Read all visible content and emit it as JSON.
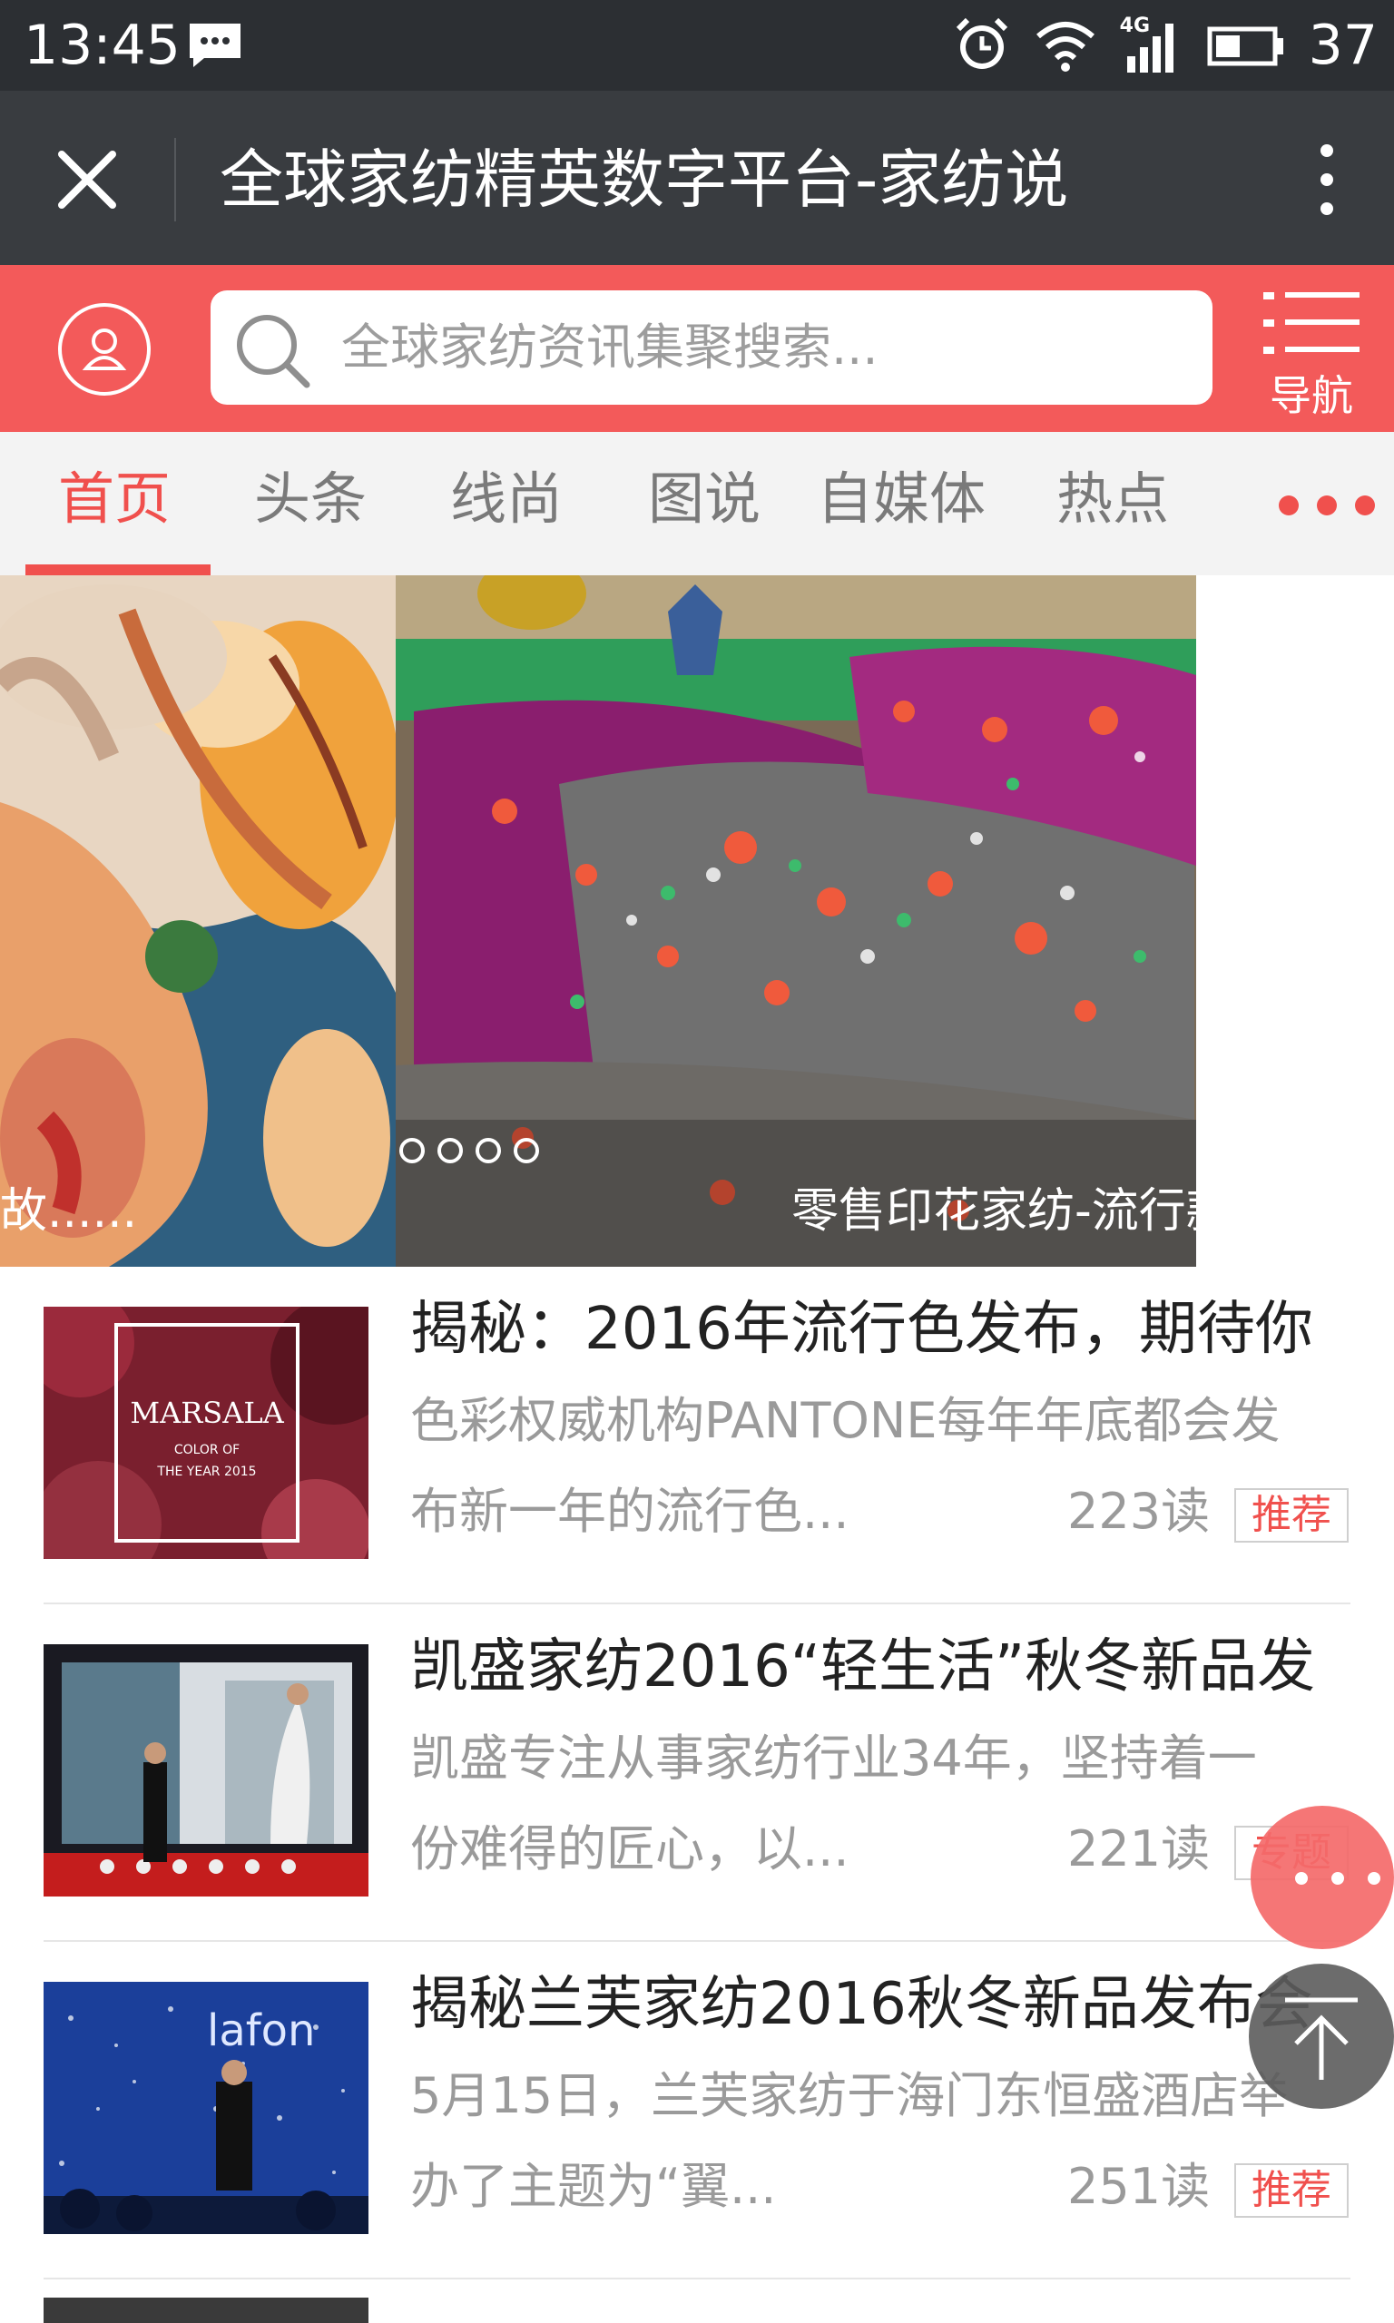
{
  "status_bar": {
    "time": "13:45",
    "network": "4G",
    "battery": "37",
    "icons": [
      "message-icon",
      "alarm-icon",
      "wifi-icon",
      "signal-icon",
      "battery-icon"
    ]
  },
  "title_bar": {
    "title": "全球家纺精英数字平台-家纺说"
  },
  "header": {
    "search_placeholder": "全球家纺资讯集聚搜索...",
    "nav_label": "导航"
  },
  "tabs": [
    {
      "label": "首页",
      "active": true
    },
    {
      "label": "头条",
      "active": false
    },
    {
      "label": "线尚",
      "active": false
    },
    {
      "label": "图说",
      "active": false
    },
    {
      "label": "自媒体",
      "active": false
    },
    {
      "label": "热点",
      "active": false
    }
  ],
  "banner": {
    "left_caption": "故......",
    "caption": "零售印花家纺-流行款品鉴",
    "slide_count": 4
  },
  "articles": [
    {
      "title": "揭秘：2016年流行色发布，期待你",
      "desc_line1": "色彩权威机构PANTONE每年年底都会发",
      "desc_line2": "布新一年的流行色...",
      "reads": "223读",
      "tag": "推荐",
      "thumb_text": "MARSALA",
      "thumb_sub1": "COLOR OF",
      "thumb_sub2": "THE YEAR 2015"
    },
    {
      "title": "凯盛家纺2016“轻生活”秋冬新品发",
      "desc_line1": "凯盛专注从事家纺行业34年，坚持着一",
      "desc_line2": "份难得的匠心，以...",
      "reads": "221读",
      "tag": "专题"
    },
    {
      "title": "揭秘兰芙家纺2016秋冬新品发布会",
      "desc_line1": "5月15日，兰芙家纺于海门东恒盛酒店举",
      "desc_line2": "办了主题为“翼...",
      "reads": "251读",
      "tag": "推荐",
      "thumb_text": "lafon"
    }
  ],
  "colors": {
    "accent": "#f35a5a",
    "status_bar": "#2c2f33",
    "title_bar": "#393c40"
  }
}
